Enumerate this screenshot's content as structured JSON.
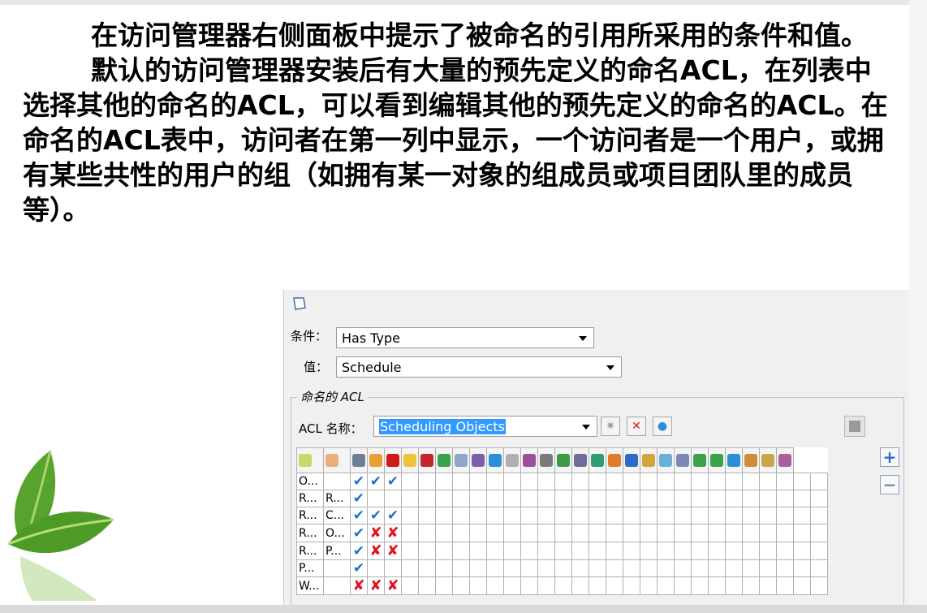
{
  "slide": {
    "paragraph1": "在访问管理器右侧面板中提示了被命名的引用所采用的条件和值。",
    "paragraph2": "默认的访问管理器安装后有大量的预先定义的命名ACL，在列表中选择其他的命名的ACL，可以看到编辑其他的预先定义的命名的ACL。在命名的ACL表中，访问者在第一列中显示，一个访问者是一个用户，或拥有某些共性的用户的组（如拥有某一对象的组成员或项目团队里的成员等）。"
  },
  "panel": {
    "condition_label": "条件：",
    "condition_value": "Has Type",
    "value_label": "值：",
    "value_value": "Schedule",
    "group_title": "命名的 ACL",
    "acl_name_label": "ACL 名称：",
    "acl_name_value": "Scheduling Objects"
  },
  "acl_rows": [
    {
      "c1": "O...",
      "c2": "",
      "marks": [
        "check",
        "check",
        "check"
      ]
    },
    {
      "c1": "R...",
      "c2": "R...",
      "marks": [
        "check",
        "",
        ""
      ]
    },
    {
      "c1": "R...",
      "c2": "C...",
      "marks": [
        "check",
        "check",
        "check"
      ]
    },
    {
      "c1": "R...",
      "c2": "O...",
      "marks": [
        "check",
        "cross",
        "cross"
      ]
    },
    {
      "c1": "R...",
      "c2": "P...",
      "marks": [
        "check",
        "cross",
        "cross"
      ]
    },
    {
      "c1": "P...",
      "c2": "",
      "marks": [
        "check",
        "",
        ""
      ]
    },
    {
      "c1": "W...",
      "c2": "",
      "marks": [
        "cross",
        "cross",
        "cross"
      ]
    }
  ],
  "header_icon_colors": [
    "#c9d86a",
    "#e7b07a",
    "#6d7f93",
    "#e8a033",
    "#d11b1b",
    "#f0c23a",
    "#c1272d",
    "#3aa34a",
    "#8fa5c9",
    "#7c5fa8",
    "#2a8fd8",
    "#b0b0b0",
    "#9a4f9a",
    "#7a7a7a",
    "#3a9a46",
    "#6d6d9a",
    "#2f9f73",
    "#e37a2a",
    "#2b6cc4",
    "#d3a63a",
    "#69b0d8",
    "#7a8ab4",
    "#3aa34a",
    "#3aa34a",
    "#2b8fd8",
    "#d08a3a",
    "#c9a64a",
    "#aa5fa0"
  ]
}
